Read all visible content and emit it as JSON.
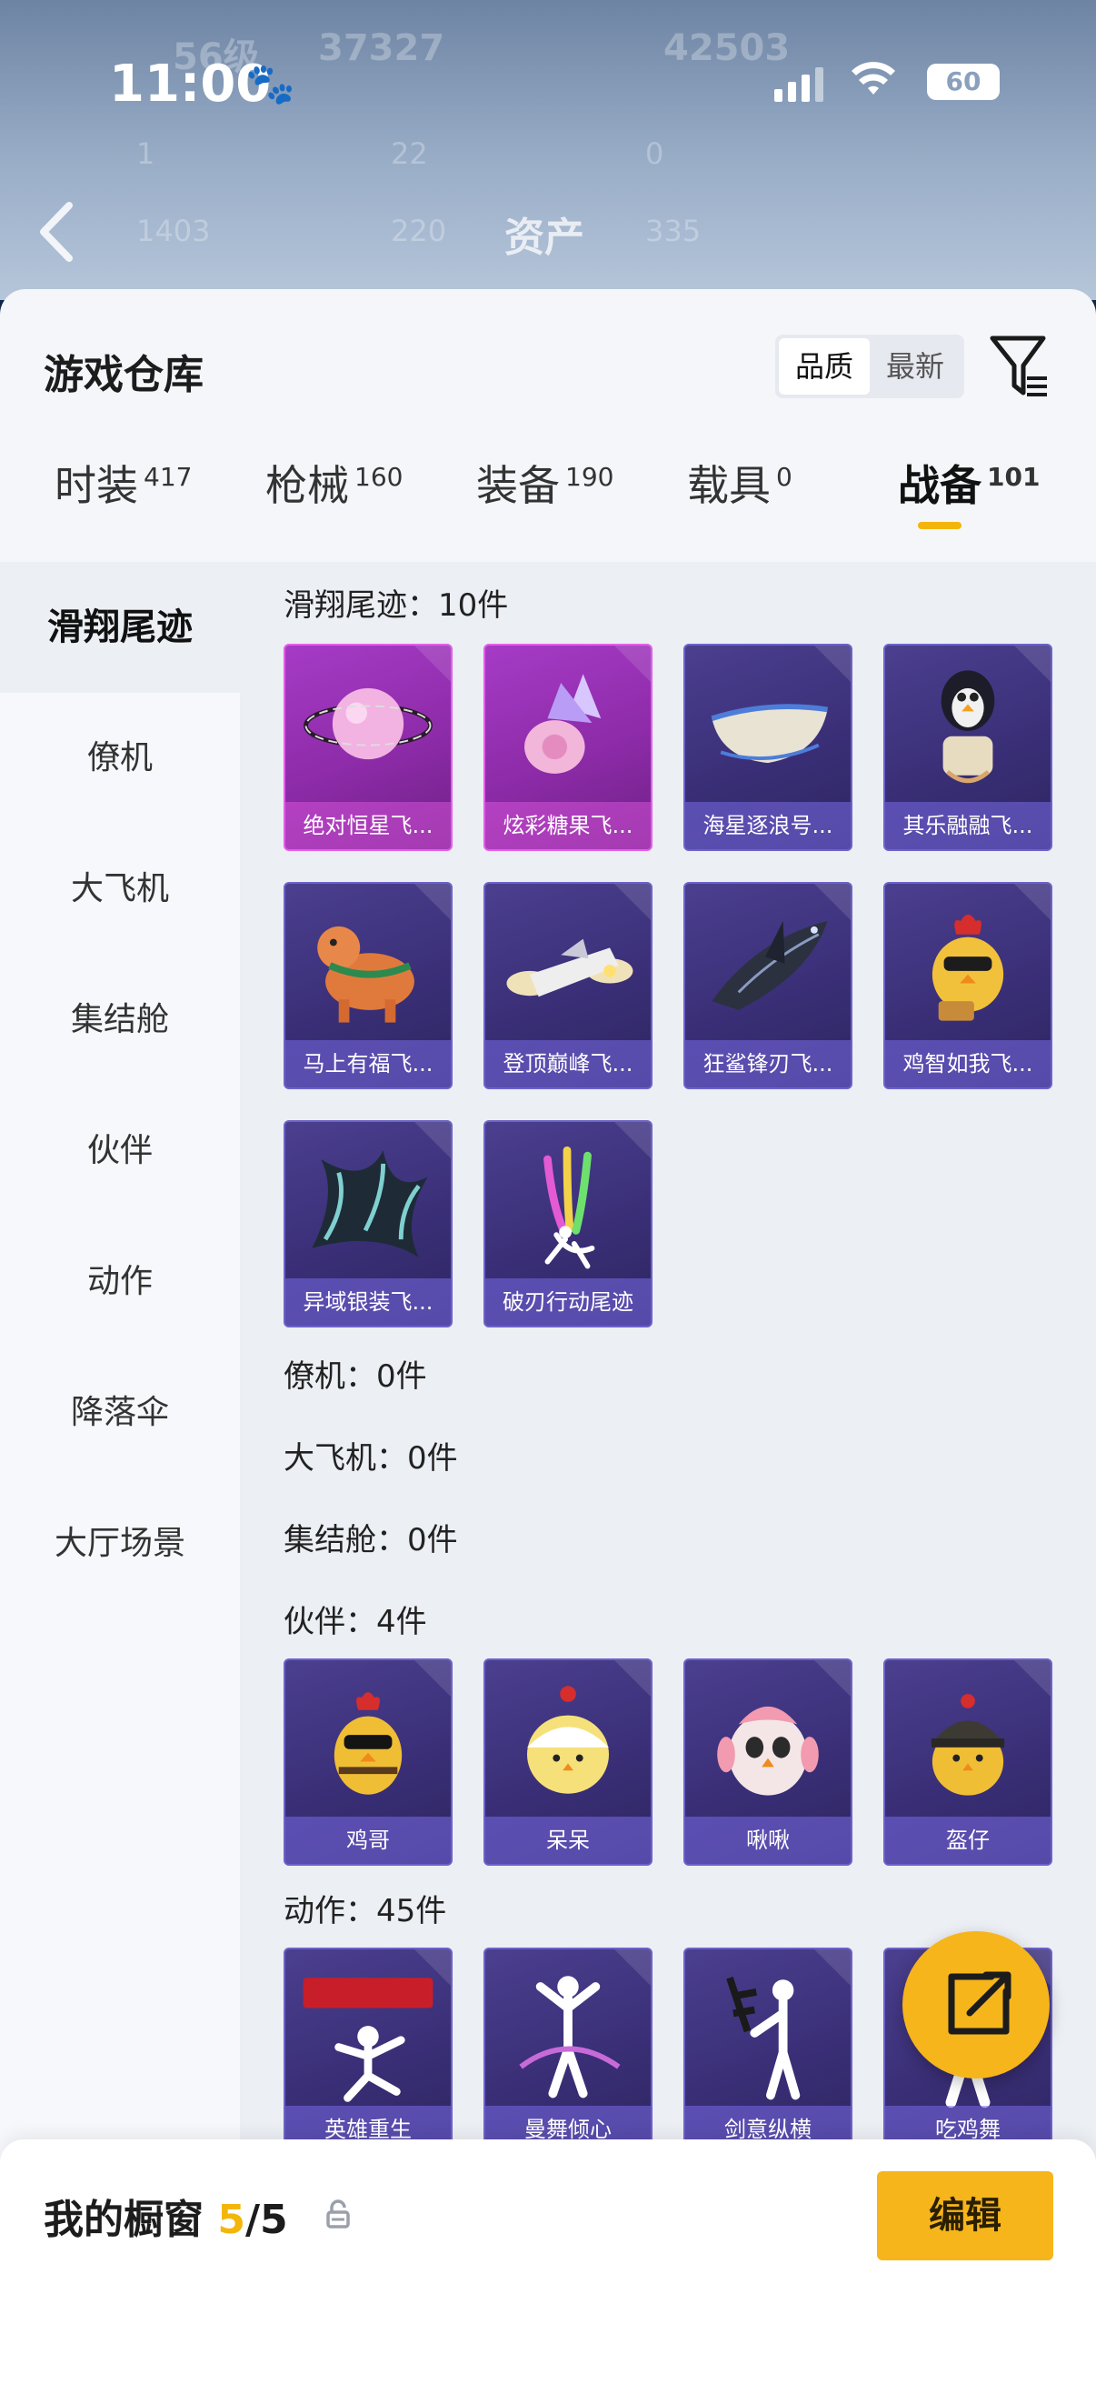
{
  "status": {
    "time": "11:00",
    "battery": "60"
  },
  "background": {
    "title": "资产",
    "ghost_level": "56级",
    "ghost_score": "37327",
    "ghost_score2": "42503",
    "ghost_a": "1",
    "ghost_b": "22",
    "ghost_c": "0",
    "ghost_d": "1403",
    "ghost_e": "220",
    "ghost_f": "335"
  },
  "sheet": {
    "title": "游戏仓库",
    "sort": {
      "options": [
        "品质",
        "最新"
      ],
      "selected": "品质"
    }
  },
  "tabs": [
    {
      "label": "时装",
      "count": "417"
    },
    {
      "label": "枪械",
      "count": "160"
    },
    {
      "label": "装备",
      "count": "190"
    },
    {
      "label": "载具",
      "count": "0"
    },
    {
      "label": "战备",
      "count": "101",
      "active": true
    }
  ],
  "sidebar": [
    "滑翔尾迹",
    "僚机",
    "大飞机",
    "集结舱",
    "伙伴",
    "动作",
    "降落伞",
    "大厅场景"
  ],
  "sections": {
    "glide": {
      "title": "滑翔尾迹：10件",
      "items": [
        "绝对恒星飞...",
        "炫彩糖果飞...",
        "海星逐浪号...",
        "其乐融融飞...",
        "马上有福飞...",
        "登顶巅峰飞...",
        "狂鲨锋刃飞...",
        "鸡智如我飞...",
        "异域银装飞...",
        "破刃行动尾迹"
      ]
    },
    "wingman": {
      "title": "僚机：0件"
    },
    "plane": {
      "title": "大飞机：0件"
    },
    "cabin": {
      "title": "集结舱：0件"
    },
    "partner": {
      "title": "伙伴：4件",
      "items": [
        "鸡哥",
        "呆呆",
        "啾啾",
        "盔仔"
      ]
    },
    "emote": {
      "title": "动作：45件",
      "items": [
        "英雄重生",
        "曼舞倾心",
        "剑意纵横",
        "吃鸡舞"
      ]
    }
  },
  "showcase": {
    "label": "我的橱窗",
    "used": "5",
    "total": "/5",
    "edit": "编辑"
  },
  "colors": {
    "accent": "#f4b50a",
    "card_purple": "#3a2f77",
    "card_pink": "#8d2ba8"
  },
  "icons": [
    "back-arrow-icon",
    "filter-icon",
    "lock-icon",
    "share-icon",
    "paw-icon",
    "wifi-icon",
    "signal-icon"
  ]
}
